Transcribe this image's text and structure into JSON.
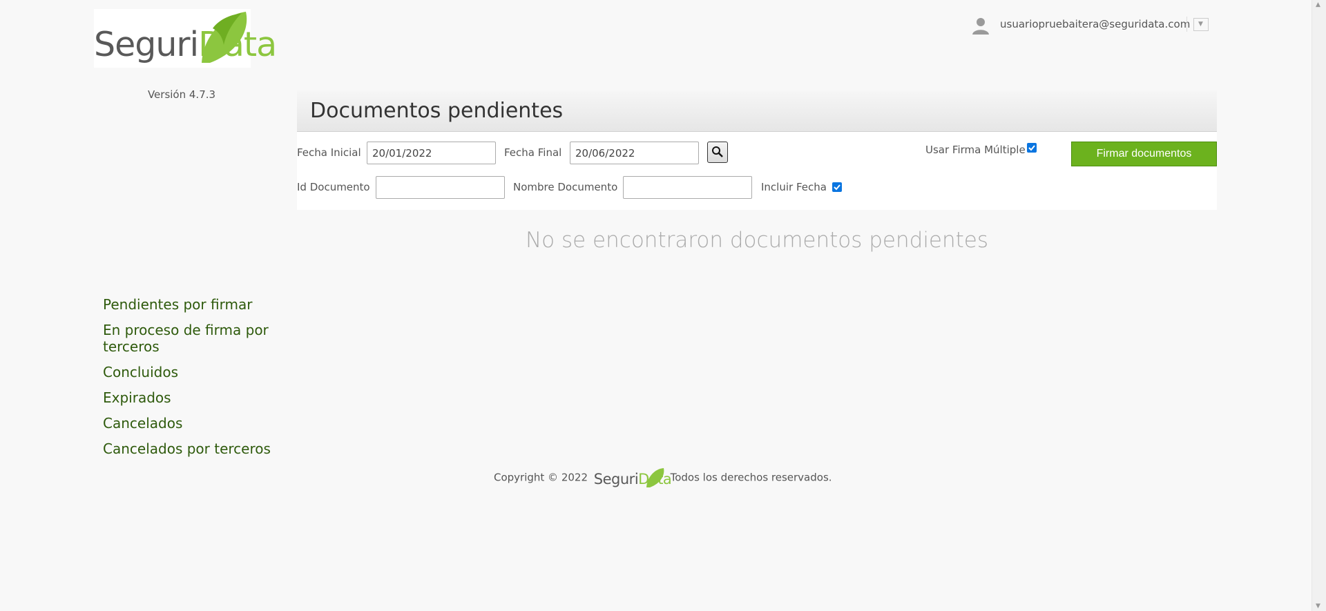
{
  "brand": {
    "name_part1": "Seguri",
    "name_part2": "Data",
    "color_accent": "#8cc63f",
    "color_dark": "#595959"
  },
  "version": "Versión 4.7.3",
  "user": {
    "email": "usuariopruebaitera@seguridata.com",
    "icon": "user-icon",
    "dropdown_icon": "chevron-down-icon"
  },
  "main": {
    "title": "Documentos pendientes",
    "filters": {
      "fecha_inicial_label": "Fecha Inicial",
      "fecha_inicial_value": "20/01/2022",
      "fecha_final_label": "Fecha Final",
      "fecha_final_value": "20/06/2022",
      "search_icon": "search-icon",
      "usar_firma_multiple_label": "Usar Firma Múltiple",
      "usar_firma_multiple_checked": true,
      "id_documento_label": "Id Documento",
      "id_documento_value": "",
      "nombre_documento_label": "Nombre Documento",
      "nombre_documento_value": "",
      "incluir_fecha_label": "Incluir Fecha",
      "incluir_fecha_checked": true
    },
    "sign_button_label": "Firmar documentos",
    "sign_button_color": "#6cb21e",
    "empty_message": "No se encontraron documentos pendientes"
  },
  "sidebar": {
    "items": [
      {
        "label": "Pendientes por firmar"
      },
      {
        "label": "En proceso de firma por terceros"
      },
      {
        "label": "Concluidos"
      },
      {
        "label": "Expirados"
      },
      {
        "label": "Cancelados"
      },
      {
        "label": "Cancelados por terceros"
      }
    ],
    "link_color": "#2e5a0c"
  },
  "footer": {
    "prefix": "Copyright © 2022",
    "suffix": "Todos los derechos reservados."
  }
}
